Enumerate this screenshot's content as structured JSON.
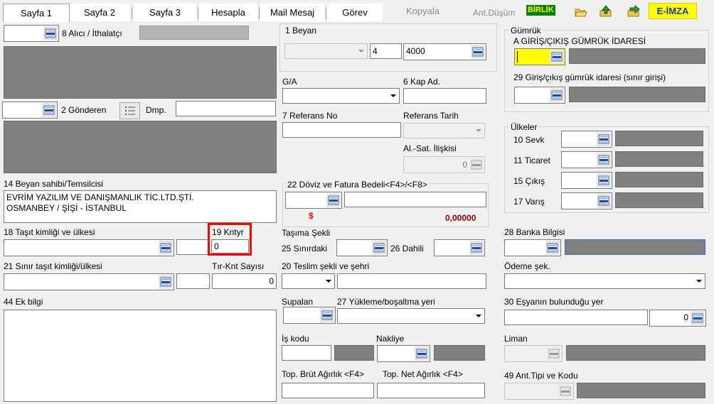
{
  "tabs": [
    {
      "label": "Sayfa 1",
      "active": true
    },
    {
      "label": "Sayfa 2"
    },
    {
      "label": "Sayfa 3"
    },
    {
      "label": "Hesapla"
    },
    {
      "label": "Mail Mesaj"
    },
    {
      "label": "Görev"
    }
  ],
  "toolbar": {
    "kopyala": "Kopyala",
    "ant_dusum": "Ant.Düşüm",
    "birlik": "BİRLİK",
    "e_imza": "E-İMZA"
  },
  "left": {
    "alici_label": "8 Alıcı / İthalatçı",
    "gonderen_label": "2 Gönderen",
    "dmp_label": "Dmp.",
    "beyan_sahibi_label": "14 Beyan sahibi/Temsilcisi",
    "beyan_sahibi_line1": "EVRİM YAZILIM VE DANIŞMANLIK TİC.LTD.ŞTİ.",
    "beyan_sahibi_line2": "OSMANBEY / ŞİŞİ - İSTANBUL",
    "tasit_label": "18 Taşıt kimliği ve ülkesi",
    "kntyr_label": "19 Kntyr",
    "kntyr_value": "0",
    "sinir_tasit_label": "21 Sınır taşıt kimliği/ülkesi",
    "tir_knt_label": "Tır-Knt Sayısı",
    "tir_knt_value": "0",
    "ek_bilgi_label": "44 Ek bilgi"
  },
  "middle": {
    "beyan_label": "1 Beyan",
    "beyan_val2": "4",
    "beyan_val3": "4000",
    "ga_label": "G/A",
    "kap_label": "6 Kap Ad.",
    "referans_no_label": "7 Referans No",
    "referans_tarih_label": "Referans Tarih",
    "al_sat_label": "Al.-Sat. İlişkisi",
    "al_sat_value": "0",
    "doviz_label": "22 Döviz ve Fatura Bedeli<F4>/<F8>",
    "doviz_symbol": "$",
    "doviz_amount": "0,00000",
    "tasima_label": "Taşıma Şekli",
    "sinirdaki_label": "25 Sınırdaki",
    "dahili_label": "26 Dahili",
    "teslim_label": "20 Teslim şekli ve şehri",
    "supalan_label": "Supalan",
    "yukleme_label": "27 Yükleme/boşaltma yeri",
    "is_kodu_label": "İş kodu",
    "nakliye_label": "Nakliye",
    "brut_label": "Top. Brüt Ağırlık <F4>",
    "net_label": "Top. Net Ağırlık <F4>"
  },
  "right": {
    "gumruk_label": "Gümrük",
    "giris_cikis_label": "A GİRİŞ/ÇIKIŞ GÜMRÜK İDARESİ",
    "sinir_girisi_label": "29 Giriş/çıkış gümrük idaresi (sınır girişi)",
    "ulkeler_label": "Ülkeler",
    "sevk_label": "10 Sevk",
    "ticaret_label": "11 Ticaret",
    "cikis_label": "15 Çıkış",
    "varis_label": "17 Varış",
    "banka_label": "28 Banka Bilgisi",
    "odeme_label": "Ödeme şek.",
    "esya_label": "30 Eşyanın bulunduğu yer",
    "esya_value": "0",
    "liman_label": "Liman",
    "ant_tipi_label": "49 Ant.Tipi ve Kodu"
  },
  "colors": {
    "accent_yellow": "#ffff00",
    "birlik_bg": "#008000",
    "birlik_fg": "#ffff00",
    "error_red": "#ff0000",
    "amount_red": "#8b0000"
  }
}
